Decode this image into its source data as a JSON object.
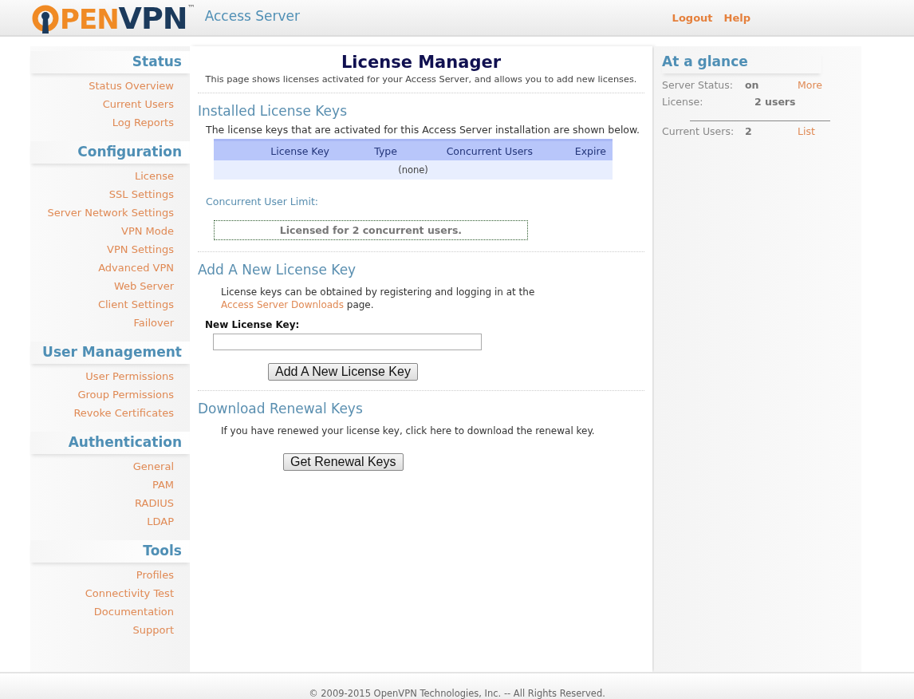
{
  "header": {
    "logo_orange": "PEN",
    "logo_navy": "VPN",
    "logo_tm": "™",
    "product": "Access Server",
    "links": [
      "Logout",
      "Help"
    ]
  },
  "sidebar": {
    "sections": [
      {
        "title": "Status",
        "items": [
          "Status Overview",
          "Current Users",
          "Log Reports"
        ]
      },
      {
        "title": "Configuration",
        "items": [
          "License",
          "SSL Settings",
          "Server Network Settings",
          "VPN Mode",
          "VPN Settings",
          "Advanced VPN",
          "Web Server",
          "Client Settings",
          "Failover"
        ]
      },
      {
        "title": "User Management",
        "items": [
          "User Permissions",
          "Group Permissions",
          "Revoke Certificates"
        ]
      },
      {
        "title": "Authentication",
        "items": [
          "General",
          "PAM",
          "RADIUS",
          "LDAP"
        ]
      },
      {
        "title": "Tools",
        "items": [
          "Profiles",
          "Connectivity Test",
          "Documentation",
          "Support"
        ]
      }
    ]
  },
  "main": {
    "title": "License Manager",
    "subtitle": "This page shows licenses activated for your Access Server, and allows you to add new licenses.",
    "installed": {
      "heading": "Installed License Keys",
      "text": "The license keys that are activated for this Access Server installation are shown below.",
      "table": {
        "columns": [
          "License Key",
          "Type",
          "Concurrent Users",
          "Expire"
        ],
        "empty": "(none)"
      },
      "limit_label": "Concurrent User Limit:",
      "limit_text": "Licensed for 2 concurrent users."
    },
    "add": {
      "heading": "Add A New License Key",
      "text_before": "License keys can be obtained by registering and logging in at the ",
      "link": "Access Server Downloads",
      "text_after": " page.",
      "field_label": "New License Key:",
      "button": "Add A New License Key"
    },
    "renew": {
      "heading": "Download Renewal Keys",
      "text": "If you have renewed your license key, click here to download the renewal key.",
      "button": "Get Renewal Keys"
    }
  },
  "glance": {
    "title": "At a glance",
    "status_label": "Server Status:",
    "status_value": "on",
    "status_link": "More",
    "license_label": "License:",
    "license_value": "2 users",
    "users_label": "Current Users:",
    "users_value": "2",
    "users_link": "List"
  },
  "footer": "© 2009-2015 OpenVPN Technologies, Inc. -- All Rights Reserved."
}
